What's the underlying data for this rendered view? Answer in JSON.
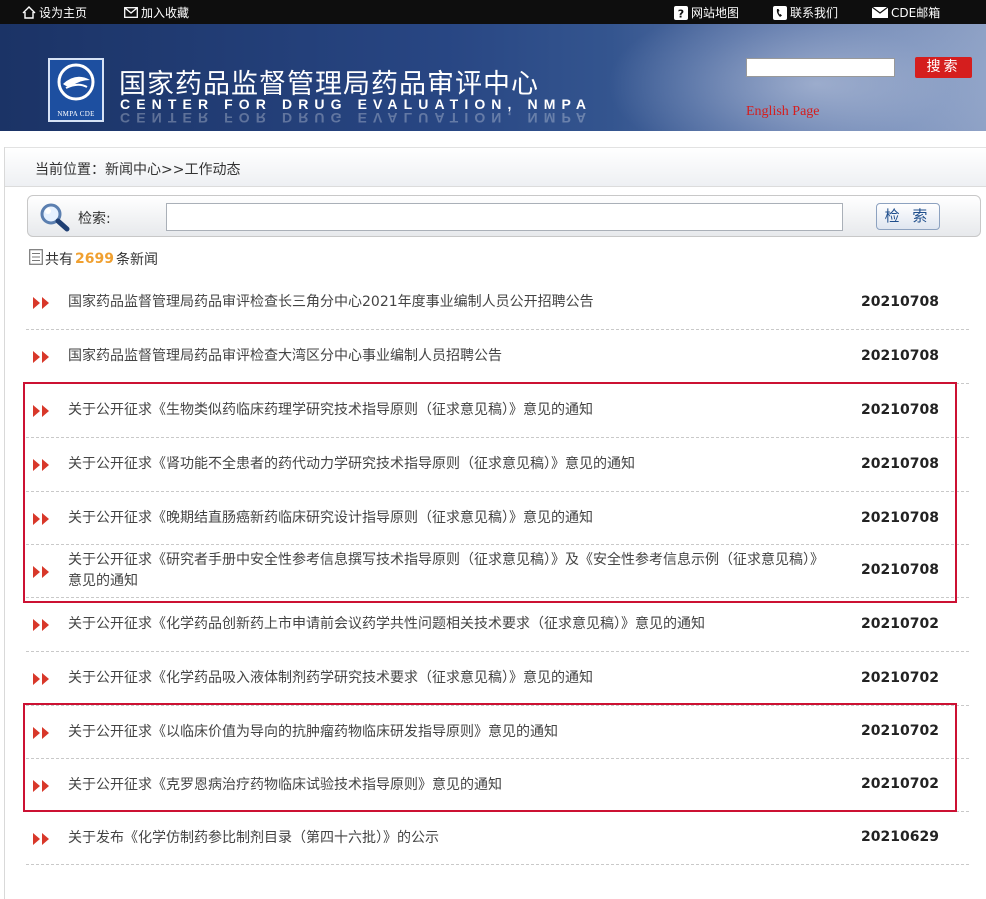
{
  "topbar": {
    "set_home": "设为主页",
    "add_favorite": "加入收藏",
    "site_map": "网站地图",
    "contact": "联系我们",
    "mail": "CDE邮箱"
  },
  "header": {
    "title": "国家药品监督管理局药品审评中心",
    "subtitle": "CENTER FOR DRUG EVALUATION, NMPA",
    "logo_text": "NMPA CDE",
    "search_button": "搜索",
    "english_link": "English Page"
  },
  "breadcrumb": "当前位置：新闻中心>>工作动态",
  "search": {
    "label": "检索:",
    "value": "",
    "button": "检 索"
  },
  "summary": {
    "prefix": "共有",
    "count": "2699",
    "suffix": "条新闻"
  },
  "news": [
    {
      "title": "国家药品监督管理局药品审评检查长三角分中心2021年度事业编制人员公开招聘公告",
      "date": "20210708"
    },
    {
      "title": "国家药品监督管理局药品审评检查大湾区分中心事业编制人员招聘公告",
      "date": "20210708"
    },
    {
      "title": "关于公开征求《生物类似药临床药理学研究技术指导原则（征求意见稿）》意见的通知",
      "date": "20210708"
    },
    {
      "title": "关于公开征求《肾功能不全患者的药代动力学研究技术指导原则（征求意见稿）》意见的通知",
      "date": "20210708"
    },
    {
      "title": "关于公开征求《晚期结直肠癌新药临床研究设计指导原则（征求意见稿）》意见的通知",
      "date": "20210708"
    },
    {
      "title": "关于公开征求《研究者手册中安全性参考信息撰写技术指导原则（征求意见稿）》及《安全性参考信息示例（征求意见稿）》意见的通知",
      "date": "20210708"
    },
    {
      "title": "关于公开征求《化学药品创新药上市申请前会议药学共性问题相关技术要求（征求意见稿）》意见的通知",
      "date": "20210702"
    },
    {
      "title": "关于公开征求《化学药品吸入液体制剂药学研究技术要求（征求意见稿）》意见的通知",
      "date": "20210702"
    },
    {
      "title": "关于公开征求《以临床价值为导向的抗肿瘤药物临床研发指导原则》意见的通知",
      "date": "20210702"
    },
    {
      "title": "关于公开征求《克罗恩病治疗药物临床试验技术指导原则》意见的通知",
      "date": "20210702"
    },
    {
      "title": "关于发布《化学仿制药参比制剂目录（第四十六批）》的公示",
      "date": "20210629"
    }
  ],
  "colors": {
    "highlight": "#cc1133",
    "arrow": "#d8382a",
    "count": "#f0a030",
    "banner": "#284683"
  }
}
